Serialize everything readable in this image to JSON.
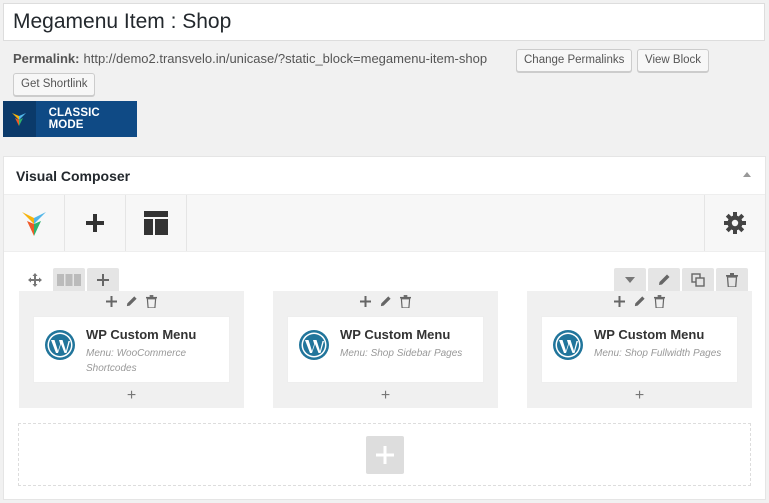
{
  "post": {
    "title": "Megamenu Item : Shop",
    "permalink_label": "Permalink:",
    "permalink_url": "http://demo2.transvelo.in/unicase/?static_block=megamenu-item-shop",
    "change_permalinks": "Change Permalinks",
    "view_block": "View Block",
    "get_shortlink": "Get Shortlink"
  },
  "classic_mode": {
    "label": "CLASSIC MODE"
  },
  "vc": {
    "title": "Visual Composer",
    "toolbar": [
      "vc-logo-icon",
      "plus-icon",
      "layout-icon",
      "gear-icon"
    ],
    "colors": {
      "accent": "#0f4a85",
      "column_bg": "#f0f0f0",
      "wp_blue": "#21759b"
    },
    "columns": [
      {
        "title": "WP Custom Menu",
        "subtitle": "Menu: WooCommerce Shortcodes"
      },
      {
        "title": "WP Custom Menu",
        "subtitle": "Menu: Shop Sidebar Pages"
      },
      {
        "title": "WP Custom Menu",
        "subtitle": "Menu: Shop Fullwidth Pages"
      }
    ]
  }
}
